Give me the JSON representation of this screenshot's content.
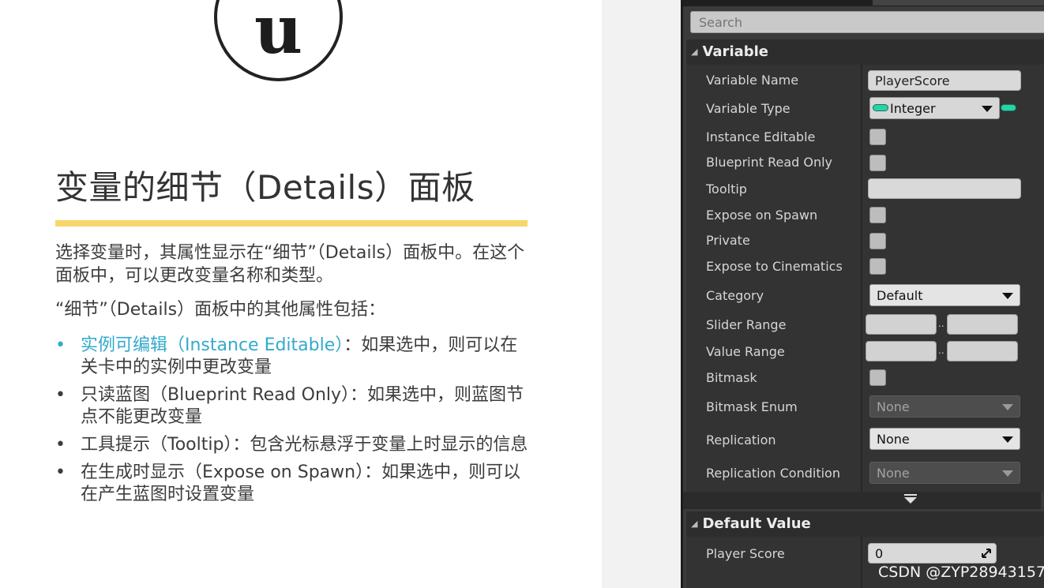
{
  "slide": {
    "logo_glyph": "u",
    "title": "变量的细节（Details）面板",
    "para1": "选择变量时，其属性显示在“细节”（Details）面板中。在这个面板中，可以更改变量名称和类型。",
    "para2": "“细节”（Details）面板中的其他属性包括：",
    "bullets": [
      {
        "highlight": "实例可编辑（Instance Editable）",
        "text": "：如果选中，则可以在关卡中的实例中更改变量"
      },
      {
        "text": "只读蓝图（Blueprint Read Only）：如果选中，则蓝图节点不能更改变量"
      },
      {
        "text": "工具提示（Tooltip）：包含光标悬浮于变量上时显示的信息"
      },
      {
        "text": "在生成时显示（Expose on Spawn）：如果选中，则可以在产生蓝图时设置变量"
      }
    ],
    "highlight_color": "#33aacc",
    "title_rule_color": "#f6d76b"
  },
  "panel": {
    "search_placeholder": "Search",
    "variable_section": "Variable",
    "labels": {
      "variable_name": "Variable Name",
      "variable_type": "Variable Type",
      "instance_editable": "Instance Editable",
      "blueprint_read_only": "Blueprint Read Only",
      "tooltip": "Tooltip",
      "expose_on_spawn": "Expose on Spawn",
      "private": "Private",
      "expose_to_cinematics": "Expose to Cinematics",
      "category": "Category",
      "slider_range": "Slider Range",
      "value_range": "Value Range",
      "bitmask": "Bitmask",
      "bitmask_enum": "Bitmask Enum",
      "replication": "Replication",
      "replication_condition": "Replication Condition"
    },
    "values": {
      "variable_name": "PlayerScore",
      "variable_type": "Integer",
      "category": "Default",
      "bitmask_enum": "None",
      "replication": "None",
      "replication_condition": "None",
      "range_separator": ".."
    },
    "default_value_section": "Default Value",
    "player_score_label": "Player Score",
    "player_score_value": "0",
    "integer_pin_color": "#29d3a6"
  },
  "watermark": "CSDN @ZYP28943157"
}
